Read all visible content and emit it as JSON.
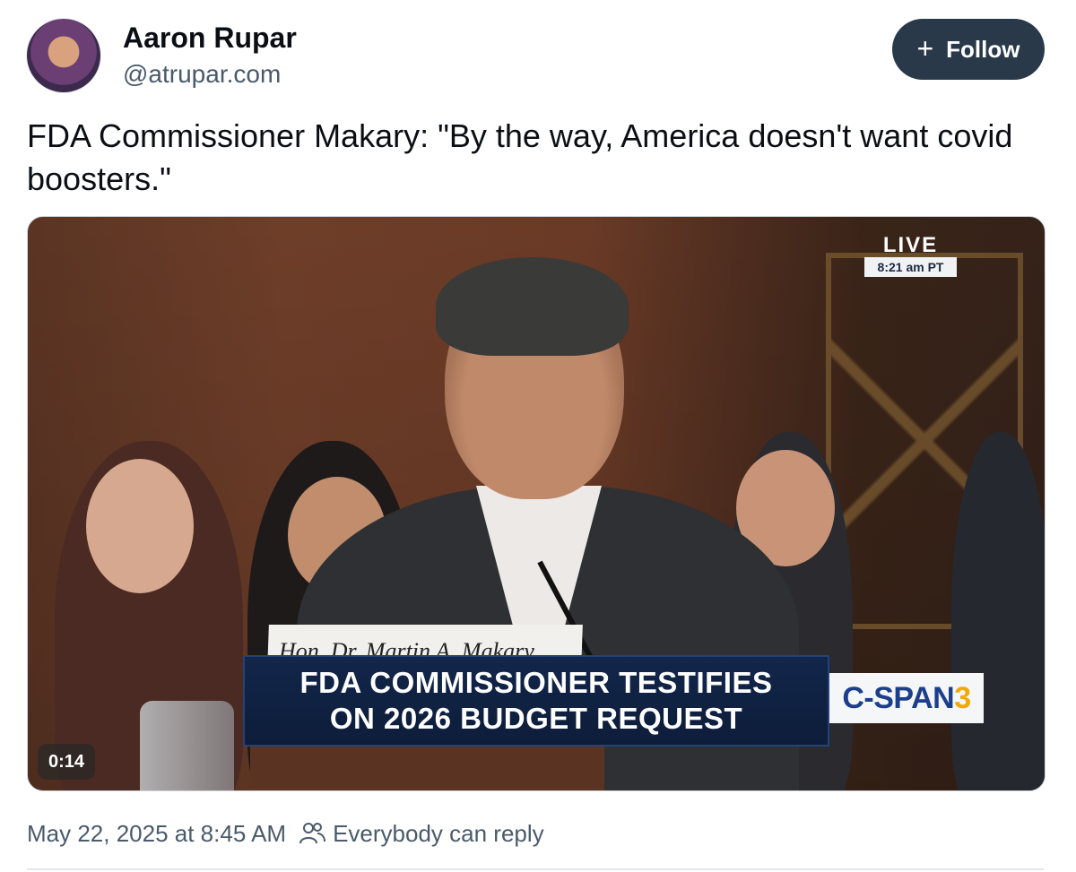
{
  "author": {
    "name": "Aaron Rupar",
    "handle": "@atrupar.com"
  },
  "follow_button": {
    "icon": "plus-icon",
    "label": "Follow"
  },
  "post": {
    "text": "FDA Commissioner Makary: \"By the way, America doesn't want covid boosters.\""
  },
  "video": {
    "live_label": "LIVE",
    "live_time": "8:21 am PT",
    "nameplate": "Hon. Dr. Martin A. Makary",
    "chyron_line1": "FDA COMMISSIONER TESTIFIES",
    "chyron_line2": "ON 2026 BUDGET REQUEST",
    "network_main": "C-SPAN",
    "network_number": "3",
    "duration": "0:14"
  },
  "meta": {
    "timestamp": "May 22, 2025 at 8:45 AM",
    "reply_setting_icon": "people-icon",
    "reply_setting": "Everybody can reply"
  },
  "colors": {
    "follow_bg": "#29394a",
    "handle_text": "#4a5a6b",
    "chyron_bg": "#13264a",
    "network_blue": "#1c3f8c",
    "network_yellow": "#f2a900"
  }
}
